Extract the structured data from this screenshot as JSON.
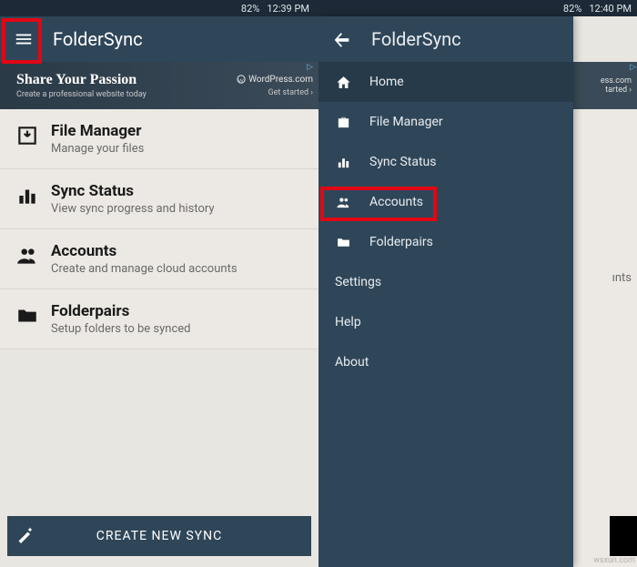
{
  "status": {
    "signal": "82%",
    "time_left": "12:39 PM",
    "time_right": "12:40 PM"
  },
  "left": {
    "app_title": "FolderSync",
    "ad": {
      "title": "Share Your Passion",
      "sub": "Create a professional website today",
      "brand": "WordPress.com",
      "cta": "Get started ›"
    },
    "rows": [
      {
        "title": "File Manager",
        "sub": "Manage your files"
      },
      {
        "title": "Sync Status",
        "sub": "View sync progress and history"
      },
      {
        "title": "Accounts",
        "sub": "Create and manage cloud accounts"
      },
      {
        "title": "Folderpairs",
        "sub": "Setup folders to be synced"
      }
    ],
    "create": "CREATE NEW SYNC"
  },
  "right": {
    "app_title": "FolderSync",
    "drawer": [
      {
        "label": "Home"
      },
      {
        "label": "File Manager"
      },
      {
        "label": "Sync Status"
      },
      {
        "label": "Accounts"
      },
      {
        "label": "Folderpairs"
      },
      {
        "label": "Settings"
      },
      {
        "label": "Help"
      },
      {
        "label": "About"
      }
    ],
    "partial_ad": {
      "brand": "ess.com",
      "cta": "tarted ›"
    },
    "partial_row": "ınts"
  },
  "watermark": "wsxun.com"
}
